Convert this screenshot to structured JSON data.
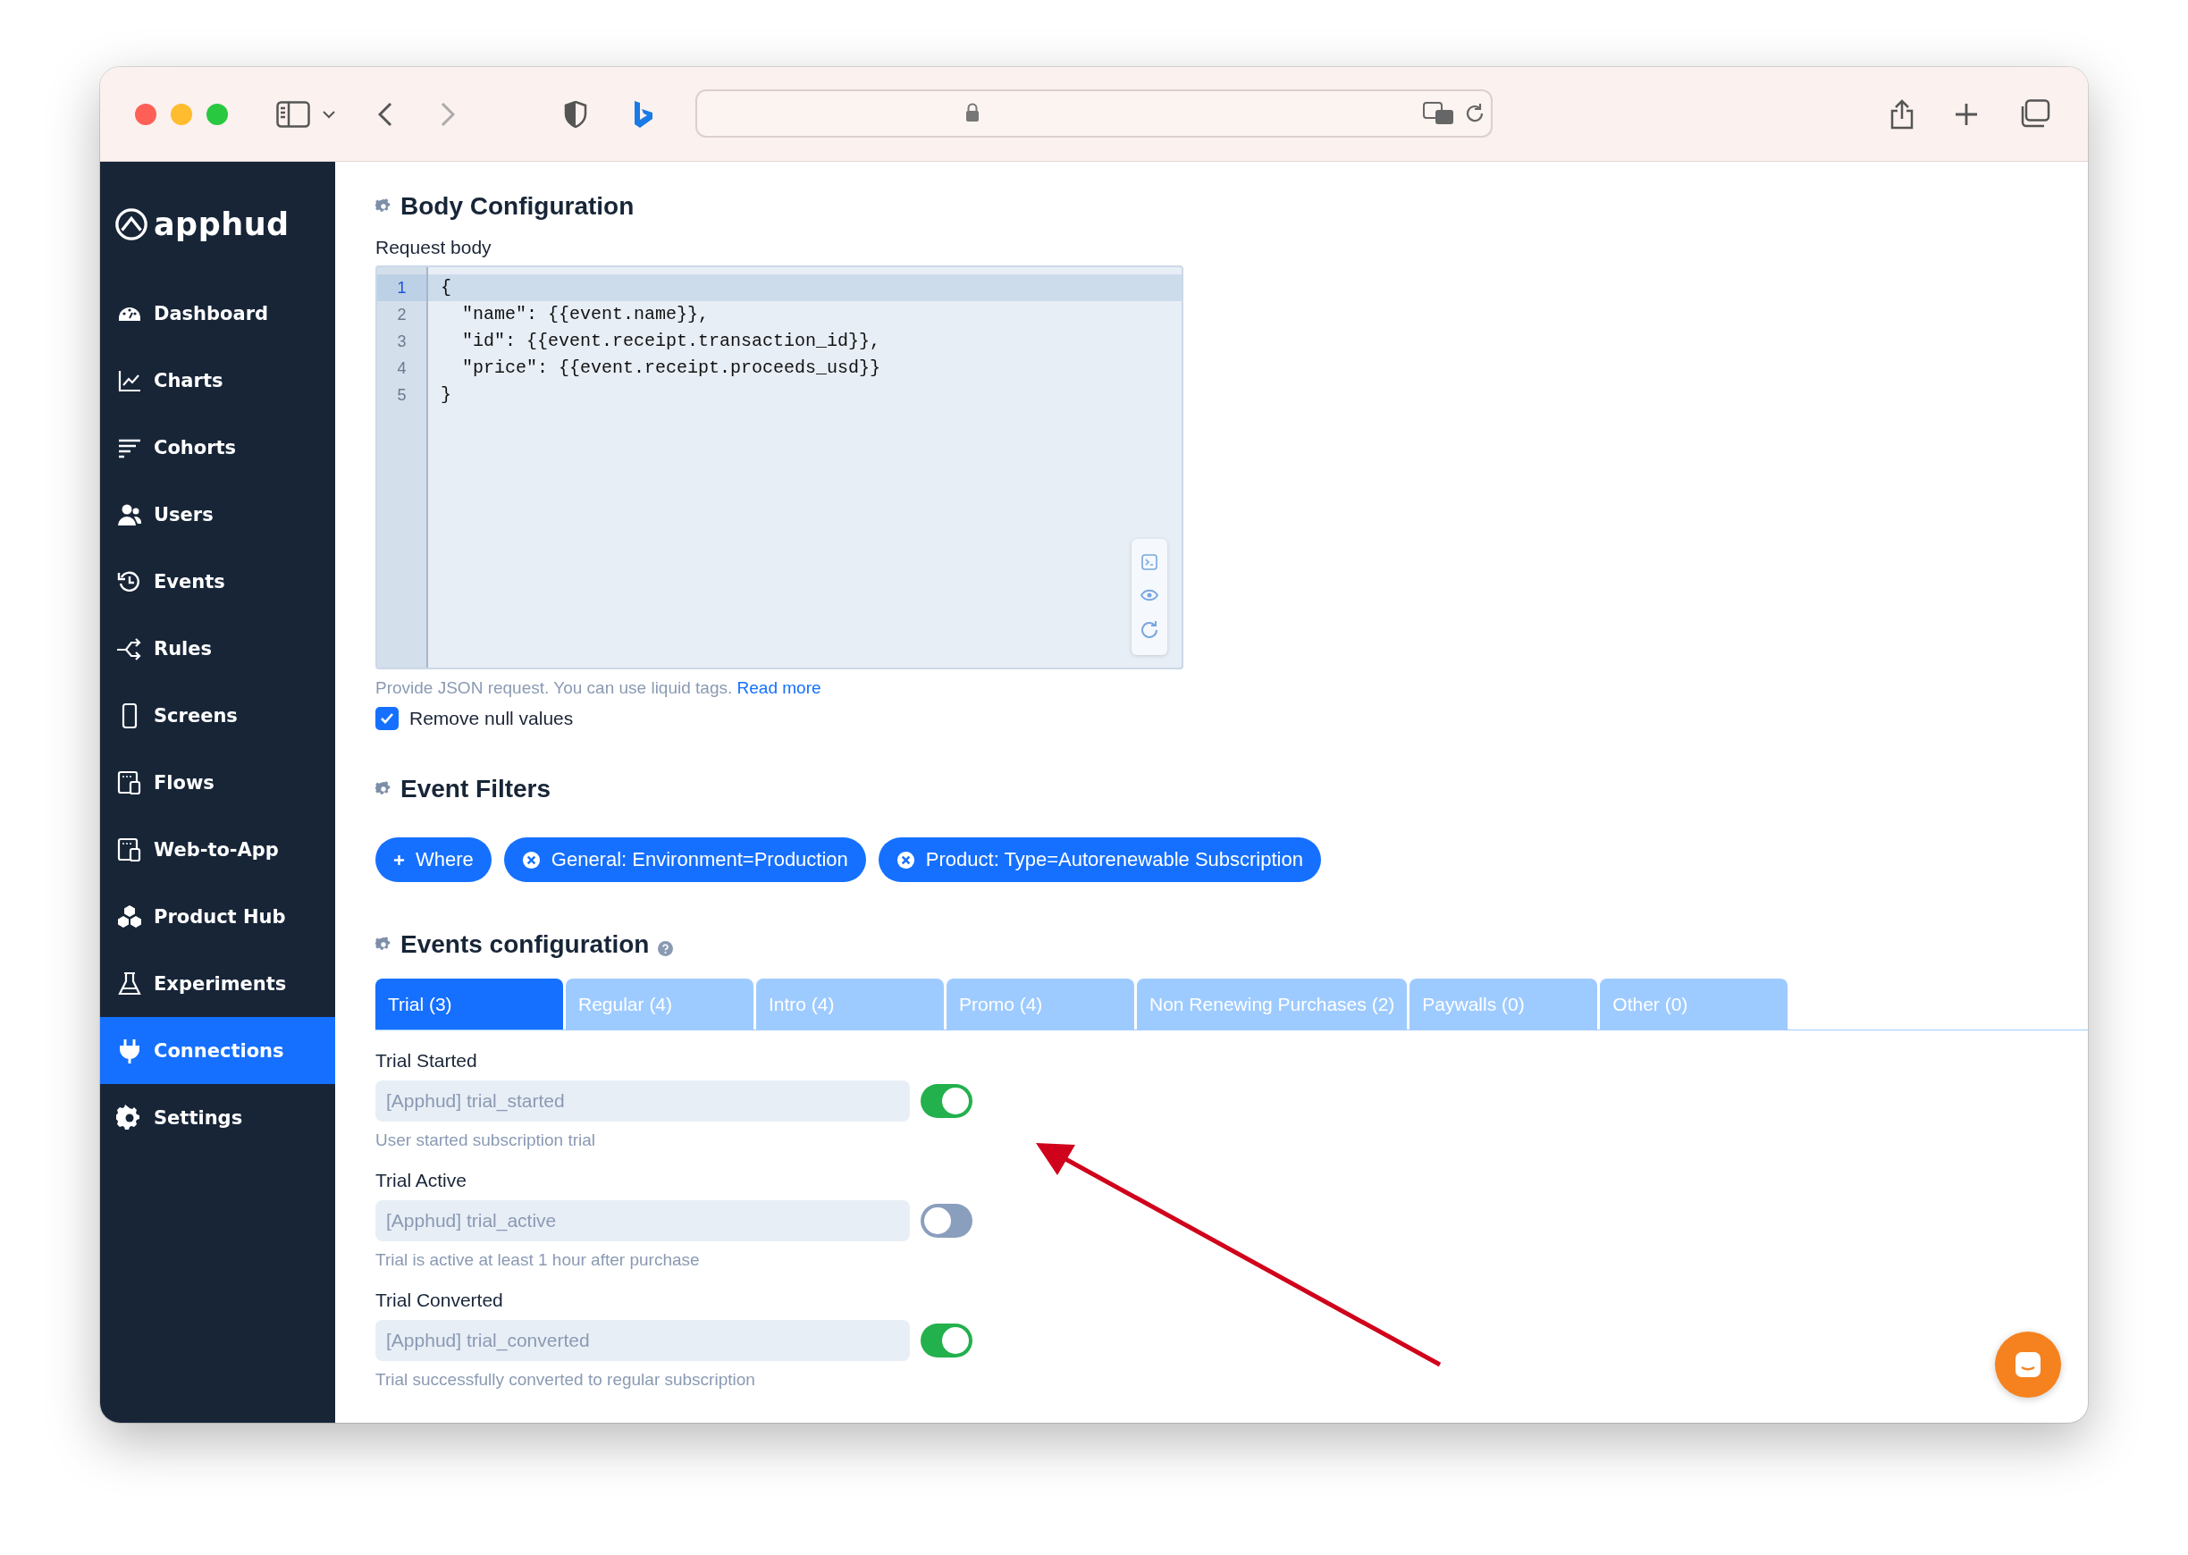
{
  "sidebar": {
    "logo": "apphud",
    "items": [
      {
        "label": "Dashboard",
        "selected": false
      },
      {
        "label": "Charts",
        "selected": false
      },
      {
        "label": "Cohorts",
        "selected": false
      },
      {
        "label": "Users",
        "selected": false
      },
      {
        "label": "Events",
        "selected": false
      },
      {
        "label": "Rules",
        "selected": false
      },
      {
        "label": "Screens",
        "selected": false
      },
      {
        "label": "Flows",
        "selected": false
      },
      {
        "label": "Web-to-App",
        "selected": false
      },
      {
        "label": "Product Hub",
        "selected": false
      },
      {
        "label": "Experiments",
        "selected": false
      },
      {
        "label": "Connections",
        "selected": true
      },
      {
        "label": "Settings",
        "selected": false
      }
    ]
  },
  "body_configuration": {
    "title": "Body Configuration",
    "label": "Request body",
    "code_lines": [
      {
        "number": "1",
        "text": "{",
        "selected": true
      },
      {
        "number": "2",
        "text": "  \"name\": {{event.name}},",
        "selected": false
      },
      {
        "number": "3",
        "text": "  \"id\": {{event.receipt.transaction_id}},",
        "selected": false
      },
      {
        "number": "4",
        "text": "  \"price\": {{event.receipt.proceeds_usd}}",
        "selected": false
      },
      {
        "number": "5",
        "text": "}",
        "selected": false
      }
    ],
    "hint": "Provide JSON request. You can use liquid tags.",
    "hint_link": "Read more",
    "remove_null": {
      "label": "Remove null values",
      "checked": true
    }
  },
  "event_filters": {
    "title": "Event Filters",
    "chips": [
      {
        "kind": "add",
        "label": "Where"
      },
      {
        "kind": "remove",
        "label": "General: Environment=Production"
      },
      {
        "kind": "remove",
        "label": "Product: Type=Autorenewable Subscription"
      }
    ]
  },
  "events_configuration": {
    "title": "Events configuration",
    "tabs": [
      {
        "label": "Trial (3)",
        "selected": true
      },
      {
        "label": "Regular (4)",
        "selected": false
      },
      {
        "label": "Intro (4)",
        "selected": false
      },
      {
        "label": "Promo (4)",
        "selected": false
      },
      {
        "label": "Non Renewing Purchases (2)",
        "selected": false
      },
      {
        "label": "Paywalls (0)",
        "selected": false
      },
      {
        "label": "Other (0)",
        "selected": false
      }
    ],
    "events": [
      {
        "name": "Trial Started",
        "placeholder": "[Apphud] trial_started",
        "on": true,
        "description": "User started subscription trial"
      },
      {
        "name": "Trial Active",
        "placeholder": "[Apphud] trial_active",
        "on": false,
        "description": "Trial is active at least 1 hour after purchase"
      },
      {
        "name": "Trial Converted",
        "placeholder": "[Apphud] trial_converted",
        "on": true,
        "description": "Trial successfully converted to regular subscription"
      }
    ]
  }
}
